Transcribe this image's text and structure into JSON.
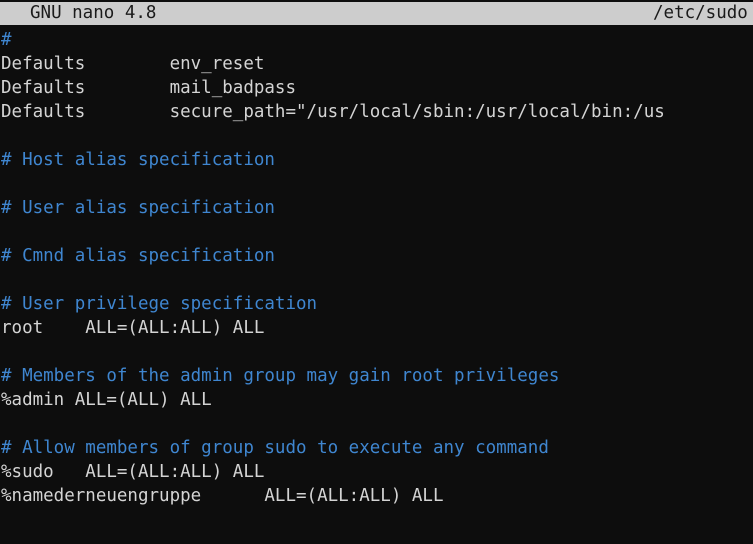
{
  "editor": {
    "name": "GNU nano",
    "version_label": "GNU nano 4.8",
    "filename_label": "/etc/sudo",
    "full_filename": "/etc/sudoers",
    "colors": {
      "background": "#0d0d0d",
      "foreground": "#d4d4d4",
      "comment": "#3f86d0",
      "titlebar_background": "#cdcdcd",
      "titlebar_foreground": "#1a1a1a"
    }
  },
  "buffer": {
    "lines": [
      {
        "text": "#",
        "kind": "comment"
      },
      {
        "text": "Defaults        env_reset",
        "kind": "normal"
      },
      {
        "text": "Defaults        mail_badpass",
        "kind": "normal"
      },
      {
        "text": "Defaults        secure_path=\"/usr/local/sbin:/usr/local/bin:/us",
        "kind": "normal"
      },
      {
        "text": "",
        "kind": "blank"
      },
      {
        "text": "# Host alias specification",
        "kind": "comment"
      },
      {
        "text": "",
        "kind": "blank"
      },
      {
        "text": "# User alias specification",
        "kind": "comment"
      },
      {
        "text": "",
        "kind": "blank"
      },
      {
        "text": "# Cmnd alias specification",
        "kind": "comment"
      },
      {
        "text": "",
        "kind": "blank"
      },
      {
        "text": "# User privilege specification",
        "kind": "comment"
      },
      {
        "text": "root    ALL=(ALL:ALL) ALL",
        "kind": "normal"
      },
      {
        "text": "",
        "kind": "blank"
      },
      {
        "text": "# Members of the admin group may gain root privileges",
        "kind": "comment"
      },
      {
        "text": "%admin ALL=(ALL) ALL",
        "kind": "normal"
      },
      {
        "text": "",
        "kind": "blank"
      },
      {
        "text": "# Allow members of group sudo to execute any command",
        "kind": "comment"
      },
      {
        "text": "%sudo   ALL=(ALL:ALL) ALL",
        "kind": "normal"
      },
      {
        "text": "%namederneuengruppe      ALL=(ALL:ALL) ALL",
        "kind": "normal"
      }
    ]
  }
}
